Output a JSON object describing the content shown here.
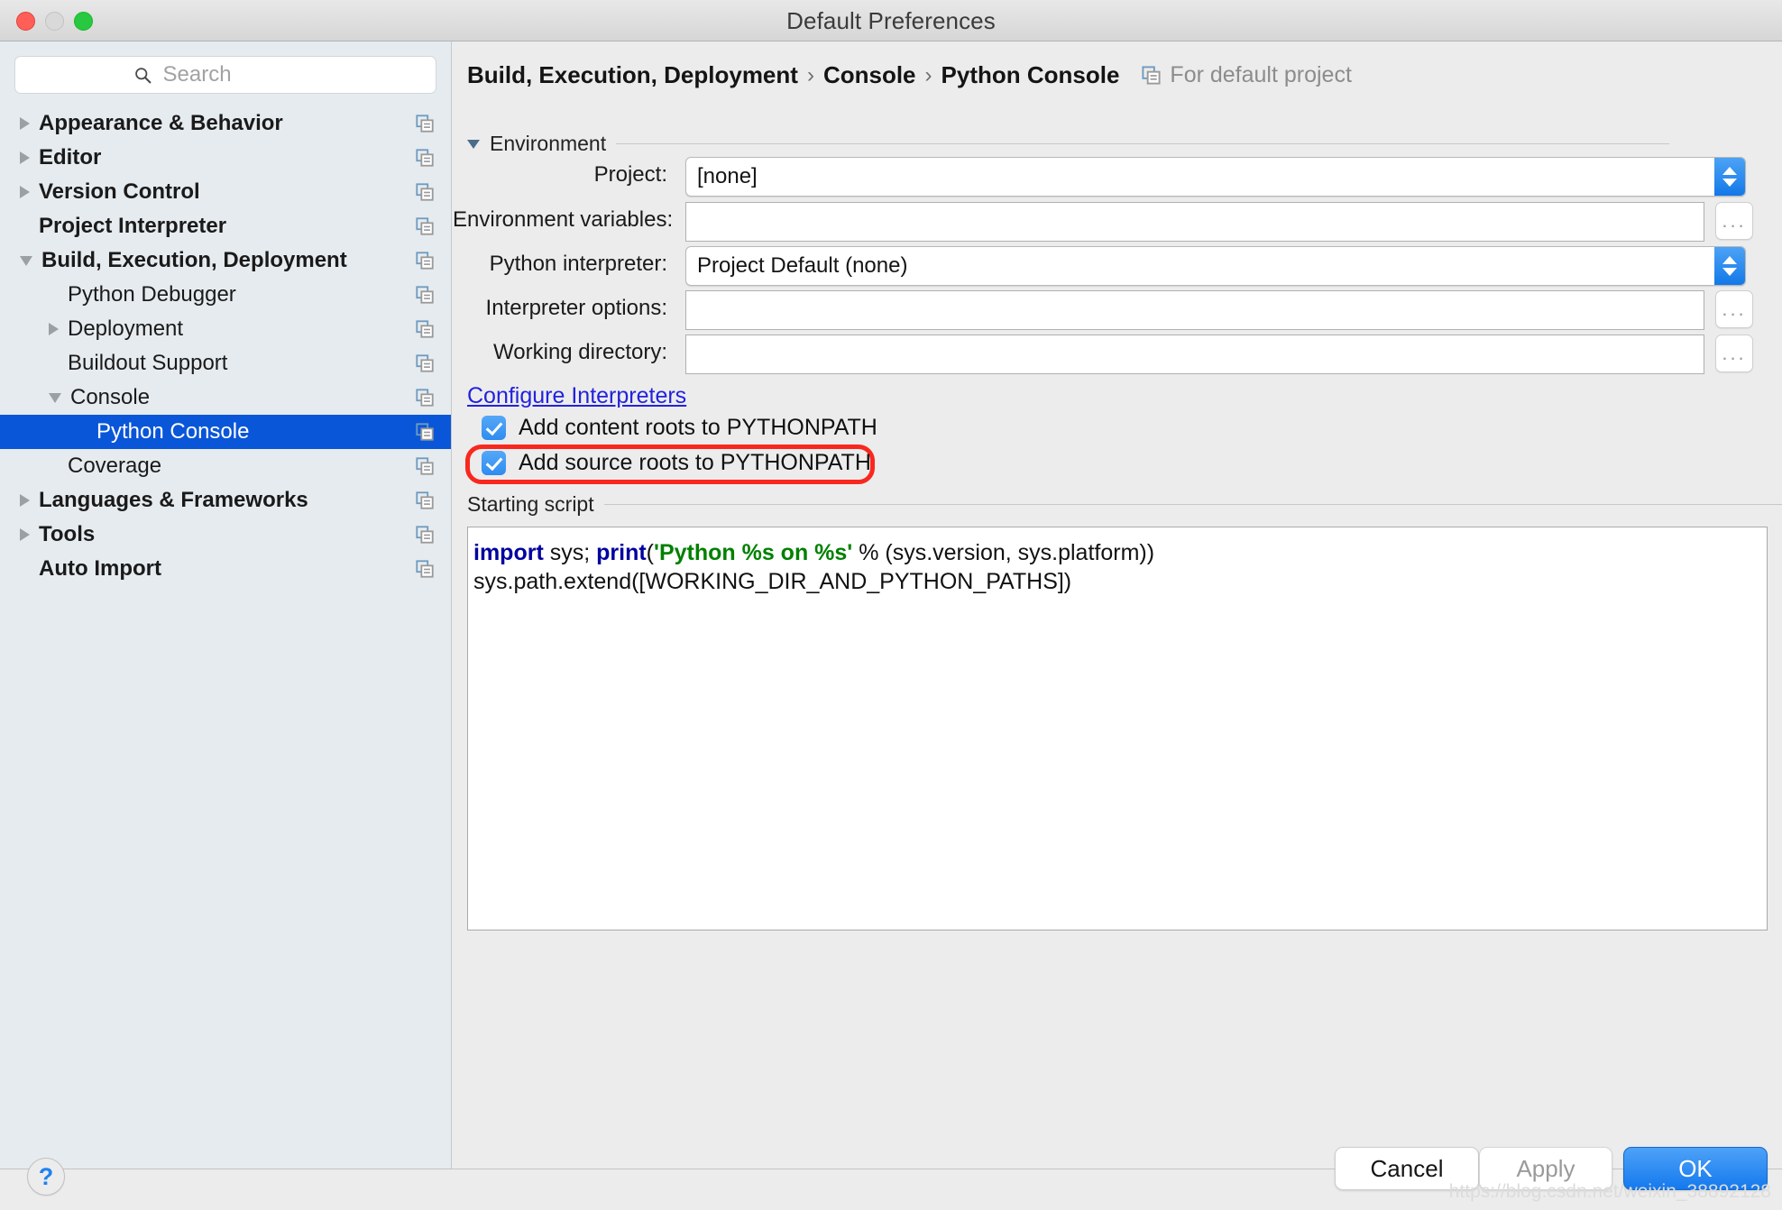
{
  "window": {
    "title": "Default Preferences",
    "traffic_lights": [
      "close-red",
      "minimize-yellow",
      "zoom-green"
    ]
  },
  "sidebar": {
    "search": {
      "placeholder": "Search",
      "value": "",
      "icon": "search-icon"
    },
    "items": [
      {
        "label": "Appearance & Behavior",
        "indent": 0,
        "twisty": "right",
        "bold": true,
        "selected": false,
        "copy_icon": "copy-settings-icon"
      },
      {
        "label": "Editor",
        "indent": 0,
        "twisty": "right",
        "bold": true,
        "selected": false,
        "copy_icon": "copy-settings-icon"
      },
      {
        "label": "Version Control",
        "indent": 0,
        "twisty": "right",
        "bold": true,
        "selected": false,
        "copy_icon": "copy-settings-icon"
      },
      {
        "label": "Project Interpreter",
        "indent": 0,
        "twisty": "none",
        "bold": true,
        "selected": false,
        "copy_icon": "copy-settings-icon"
      },
      {
        "label": "Build, Execution, Deployment",
        "indent": 0,
        "twisty": "down",
        "bold": true,
        "selected": false,
        "copy_icon": "copy-settings-icon"
      },
      {
        "label": "Python Debugger",
        "indent": 1,
        "twisty": "none",
        "bold": false,
        "selected": false,
        "copy_icon": "copy-settings-icon"
      },
      {
        "label": "Deployment",
        "indent": 1,
        "twisty": "right",
        "bold": false,
        "selected": false,
        "copy_icon": "copy-settings-icon"
      },
      {
        "label": "Buildout Support",
        "indent": 1,
        "twisty": "none",
        "bold": false,
        "selected": false,
        "copy_icon": "copy-settings-icon"
      },
      {
        "label": "Console",
        "indent": 1,
        "twisty": "down",
        "bold": false,
        "selected": false,
        "copy_icon": "copy-settings-icon"
      },
      {
        "label": "Python Console",
        "indent": 2,
        "twisty": "none",
        "bold": false,
        "selected": true,
        "copy_icon": "copy-settings-icon"
      },
      {
        "label": "Coverage",
        "indent": 1,
        "twisty": "none",
        "bold": false,
        "selected": false,
        "copy_icon": "copy-settings-icon"
      },
      {
        "label": "Languages & Frameworks",
        "indent": 0,
        "twisty": "right",
        "bold": true,
        "selected": false,
        "copy_icon": "copy-settings-icon"
      },
      {
        "label": "Tools",
        "indent": 0,
        "twisty": "right",
        "bold": true,
        "selected": false,
        "copy_icon": "copy-settings-icon"
      },
      {
        "label": "Auto Import",
        "indent": 0,
        "twisty": "none",
        "bold": true,
        "selected": false,
        "copy_icon": "copy-settings-icon"
      }
    ],
    "selected_item": "Python Console"
  },
  "main": {
    "breadcrumb": {
      "parts": [
        "Build, Execution, Deployment",
        "Console",
        "Python Console"
      ],
      "separator": "›",
      "note": "For default project",
      "note_icon": "copy-settings-icon"
    },
    "environment_section": {
      "title": "Environment",
      "collapse_icon": "triangle-down-icon",
      "fields": [
        {
          "label": "Project:",
          "value": "[none]",
          "placeholder": "",
          "control": "combo"
        },
        {
          "label": "Environment variables:",
          "value": "",
          "placeholder": "",
          "control": "text-with-browse"
        },
        {
          "label": "Python interpreter:",
          "value": "Project Default (none)",
          "placeholder": "",
          "control": "combo"
        },
        {
          "label": "Interpreter options:",
          "value": "",
          "placeholder": "",
          "control": "text-with-browse"
        },
        {
          "label": "Working directory:",
          "value": "",
          "placeholder": "",
          "control": "text-with-browse"
        }
      ],
      "browse_button_label": "...",
      "link": "Configure Interpreters",
      "checkboxes": [
        {
          "label": "Add content roots to PYTHONPATH",
          "checked": true,
          "highlighted": false
        },
        {
          "label": "Add source roots to PYTHONPATH",
          "checked": true,
          "highlighted": true
        }
      ]
    },
    "starting_script_section": {
      "title": "Starting script",
      "code_lines": [
        [
          {
            "t": "import",
            "c": "kw"
          },
          {
            "t": " sys; ",
            "c": ""
          },
          {
            "t": "print",
            "c": "kw"
          },
          {
            "t": "(",
            "c": ""
          },
          {
            "t": "'Python %s on %s'",
            "c": "str"
          },
          {
            "t": " % (sys.version, sys.platform))",
            "c": ""
          }
        ],
        [
          {
            "t": "sys.path.extend([WORKING_DIR_AND_PYTHON_PATHS])",
            "c": ""
          }
        ]
      ]
    }
  },
  "footer": {
    "help_label": "?",
    "cancel_label": "Cancel",
    "apply_label": "Apply",
    "apply_enabled": false,
    "ok_label": "OK"
  },
  "watermark": "https://blog.csdn.net/weixin_38892128",
  "colors": {
    "selection_blue": "#0a56d8",
    "accent_blue": "#1479ee",
    "checkbox_blue": "#2f8cf0",
    "link_blue": "#2222dd",
    "highlight_red": "#f8281e",
    "keyword_navy": "#00009f",
    "string_green": "#008000",
    "sidebar_bg": "#e6ebef",
    "panel_bg": "#ececec"
  }
}
